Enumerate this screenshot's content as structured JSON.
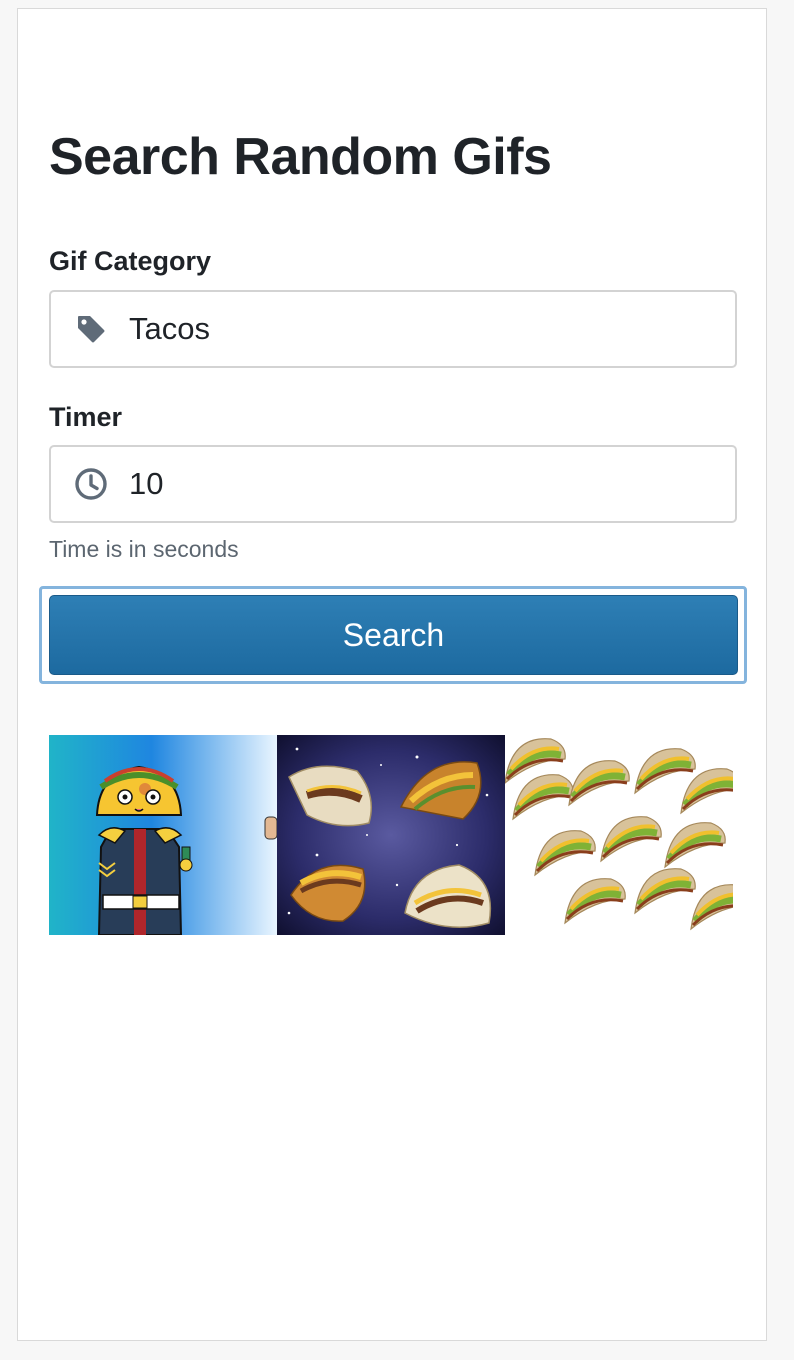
{
  "page": {
    "title": "Search Random Gifs"
  },
  "form": {
    "category": {
      "label": "Gif Category",
      "value": "Tacos",
      "icon": "tag-icon"
    },
    "timer": {
      "label": "Timer",
      "value": "10",
      "icon": "clock-icon",
      "help_text": "Time is in seconds"
    },
    "search_button_label": "Search"
  },
  "results": {
    "gifs": [
      {
        "description_icon": "taco-soldier-gif"
      },
      {
        "description_icon": "tacos-in-space-gif"
      },
      {
        "description_icon": "taco-pile-gif"
      }
    ]
  },
  "colors": {
    "accent": "#2474aa",
    "focus_ring": "#84b4dd",
    "text": "#1f2328",
    "muted": "#5c6670"
  }
}
